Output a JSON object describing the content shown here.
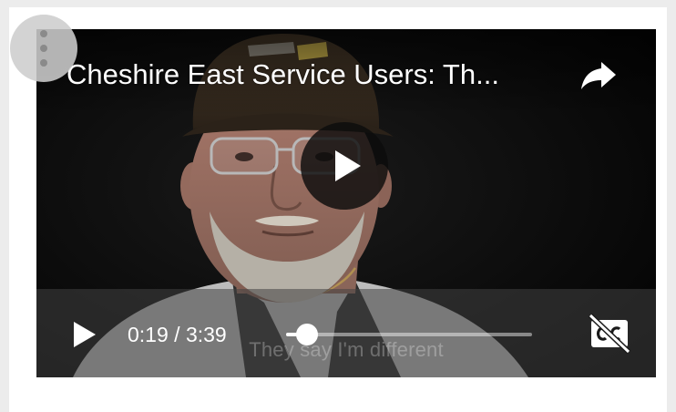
{
  "video": {
    "title": "Cheshire East Service Users: Th...",
    "current_time": "0:19",
    "duration": "3:39",
    "time_separator": " / ",
    "progress": 0.087,
    "subtitle": "They say I'm different"
  },
  "icons": {
    "share": "share-arrow-icon",
    "center_play": "play-icon",
    "play": "play-icon",
    "captions": "closed-captions-off-icon",
    "more": "vertical-dots-icon"
  },
  "colors": {
    "page_background": "#ececec",
    "card_background": "#ffffff",
    "player_background": "#000000",
    "controls_text": "#ffffff"
  }
}
